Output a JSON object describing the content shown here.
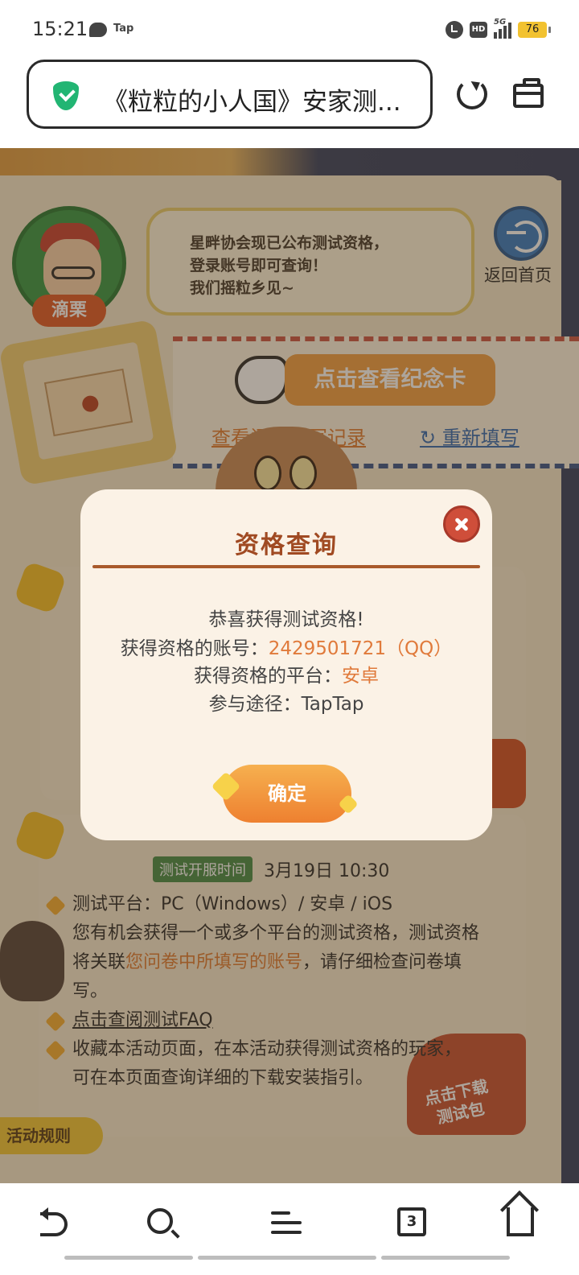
{
  "status_bar": {
    "time": "15:21",
    "tap_label": "Tap",
    "hd_label": "HD",
    "network": "5G",
    "battery": "76"
  },
  "browser": {
    "url_title": "《粒粒的小人国》安家测..."
  },
  "page": {
    "character_name": "滴栗",
    "speech": "星畔协会现已公布测试资格，\n登录账号即可查询！\n我们摇粒乡见~",
    "home_label": "返回首页",
    "cta_label": "点击查看纪念卡",
    "link_records": "查看问卷填写记录",
    "link_refill": "↻ 重新填写",
    "test_time_tag": "测试开服时间",
    "test_time": "3月19日 10:30",
    "info_platform": "测试平台：PC（Windows）/ 安卓 / iOS",
    "info_line1": "您有机会获得一个或多个平台的测试资格，测试资格",
    "info_line2_prefix": "将关联",
    "info_line2_highlight": "您问卷中所填写的账号",
    "info_line2_suffix": "，请仔细检查问卷填",
    "info_line3": "写。",
    "faq_link": "点击查阅测试FAQ",
    "info_line4": "收藏本活动页面，在本活动获得测试资格的玩家，",
    "info_line5": "可在本页面查询详细的下载安装指引。",
    "download_badge": "点击下载\n测试包",
    "rules_tab": "活动规则"
  },
  "modal": {
    "title": "资格查询",
    "congrats": "恭喜获得测试资格!",
    "account_label": "获得资格的账号：",
    "account_value": "2429501721（QQ）",
    "platform_label": "获得资格的平台：",
    "platform_value": "安卓",
    "channel_label": "参与途径：",
    "channel_value": "TapTap",
    "confirm_label": "确定"
  },
  "bottom_nav": {
    "tab_count": "3"
  },
  "colors": {
    "accent_orange": "#e07a3b",
    "modal_title": "#a04a22",
    "close_red": "#cf4e3a",
    "shield_green": "#22b573"
  }
}
